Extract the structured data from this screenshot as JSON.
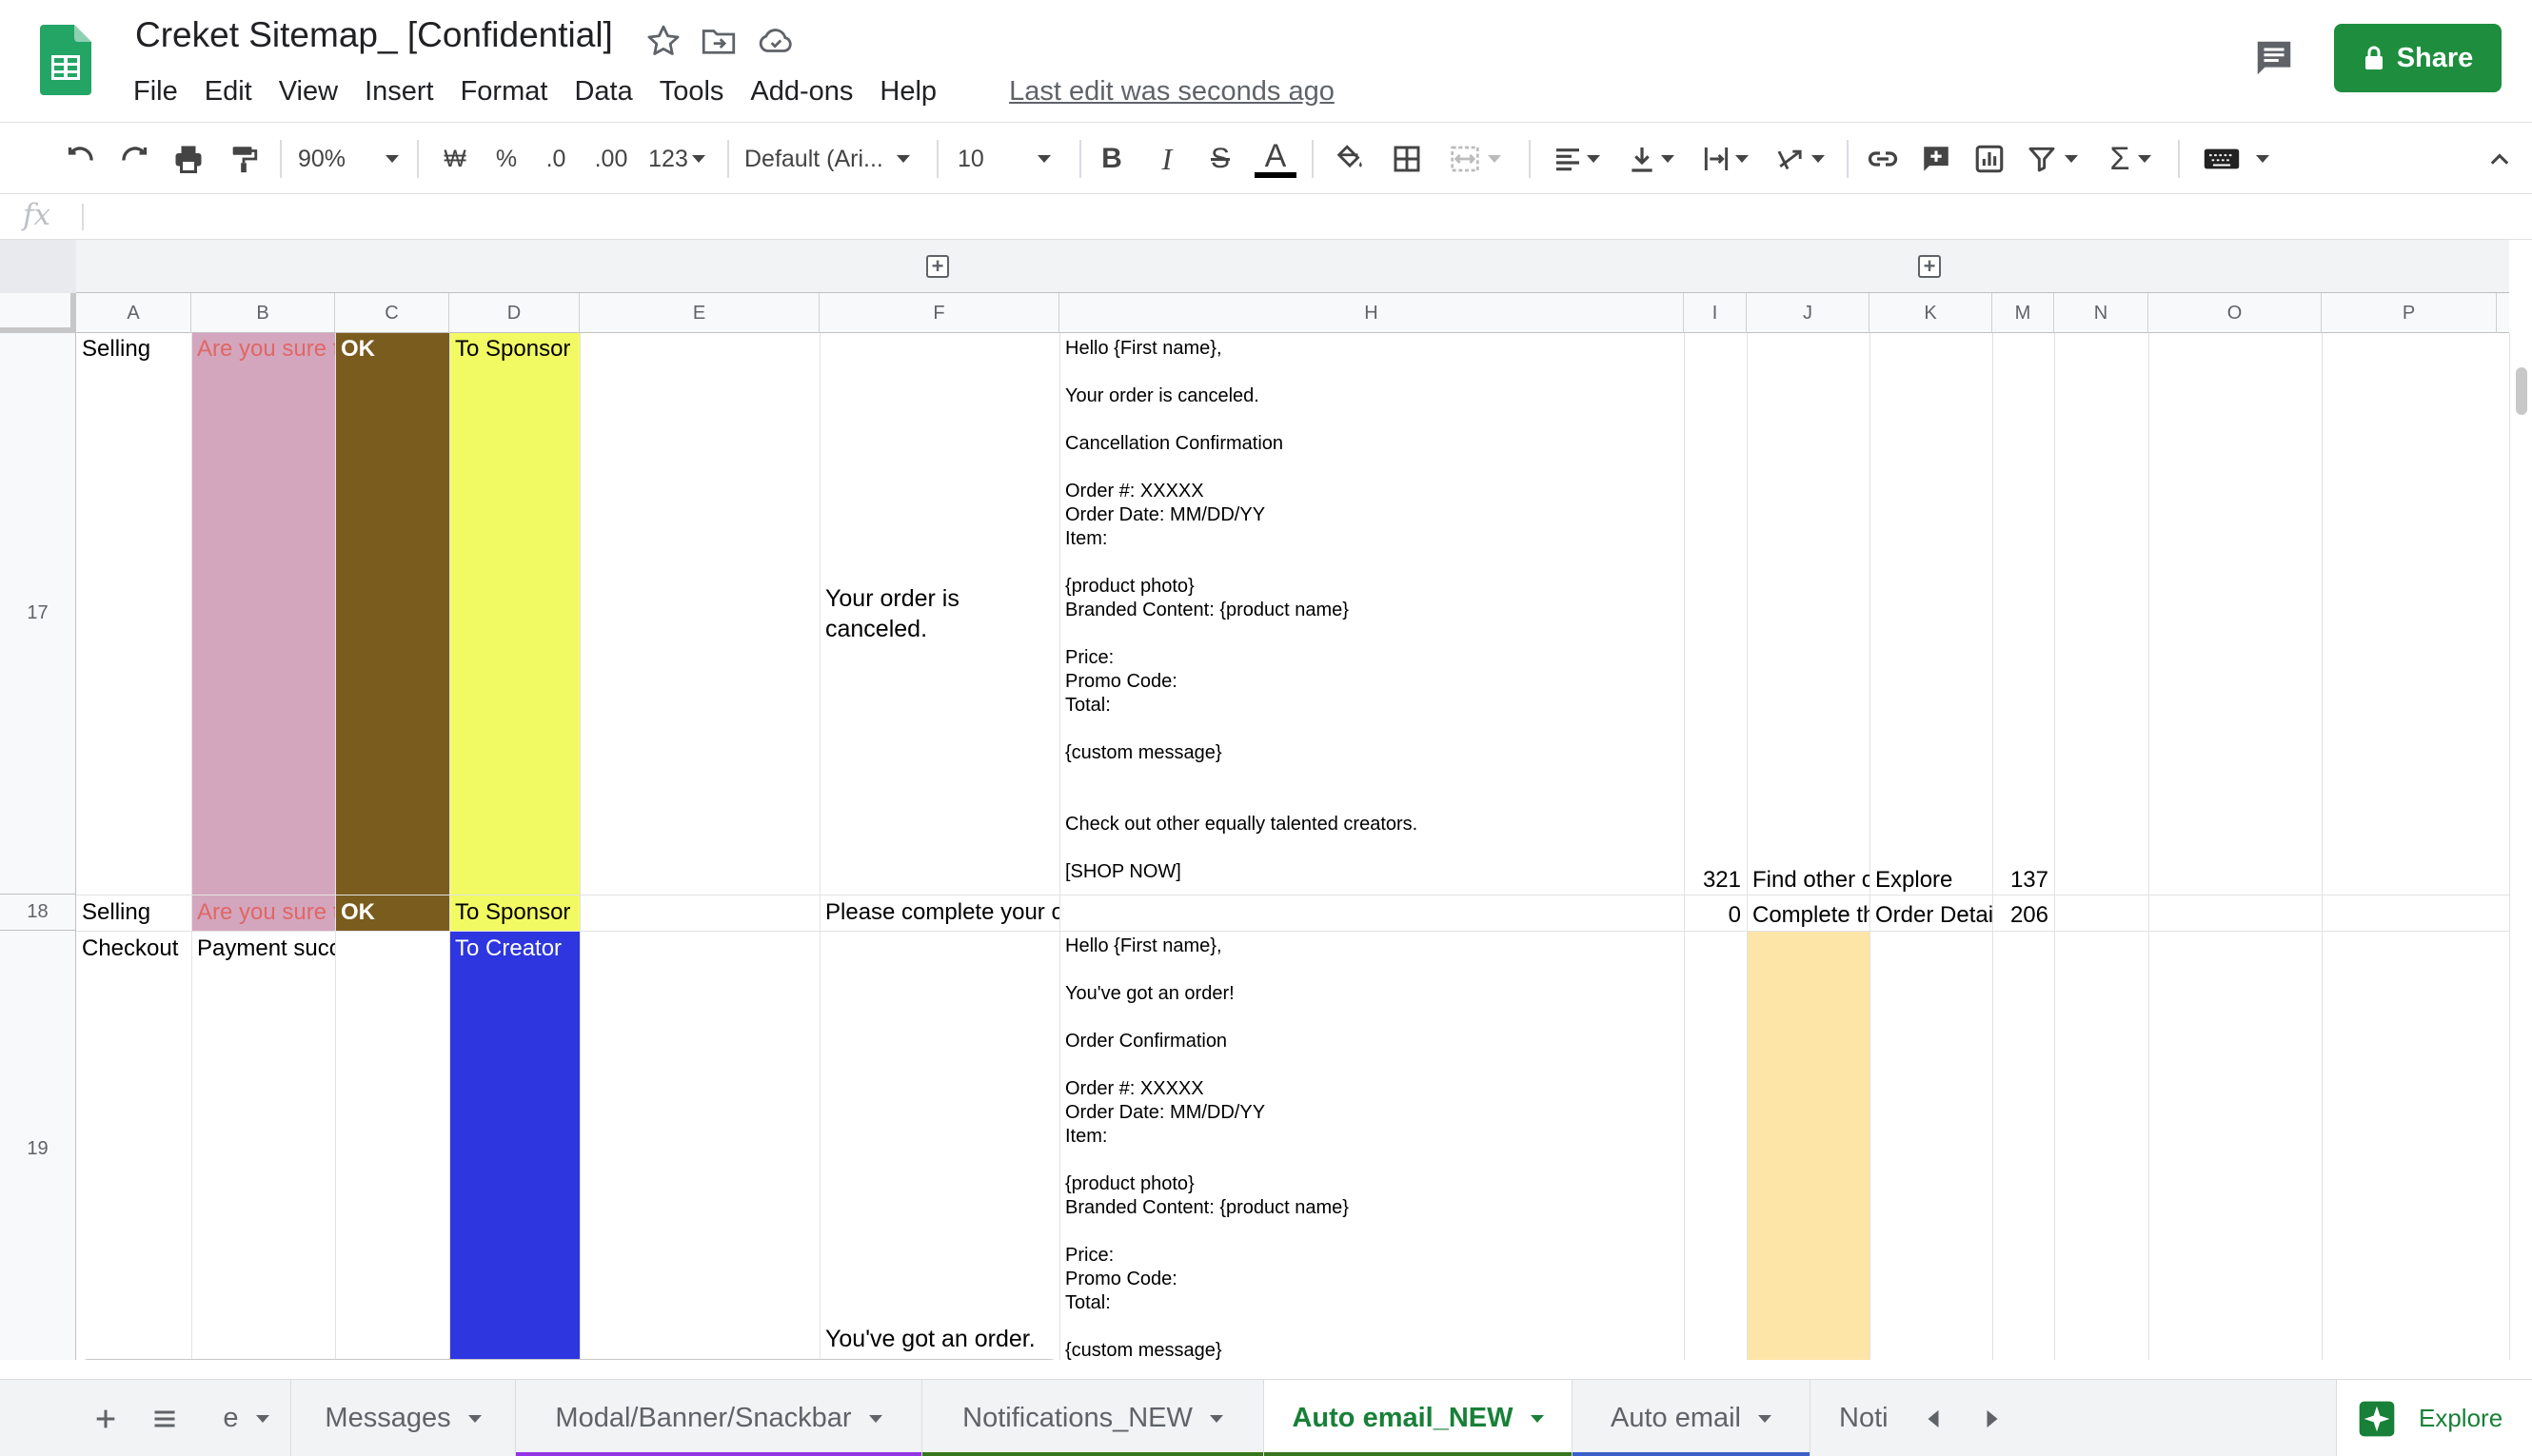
{
  "app": {
    "title": "Creket Sitemap_ [Confidential]",
    "last_edit": "Last edit was seconds ago",
    "share_label": "Share"
  },
  "menu": [
    "File",
    "Edit",
    "View",
    "Insert",
    "Format",
    "Data",
    "Tools",
    "Add-ons",
    "Help"
  ],
  "toolbar": {
    "zoom": "90%",
    "currency": "₩",
    "percent": "%",
    "decrease_decimals": ".0",
    "increase_decimals": ".00",
    "more_formats": "123",
    "font": "Default (Ari...",
    "font_size": "10",
    "bold": "B",
    "italic": "I",
    "strike": "S",
    "text_color": "A",
    "sum": "Σ"
  },
  "formula_bar": {
    "fx": "fx",
    "value": ""
  },
  "columns": [
    "A",
    "B",
    "C",
    "D",
    "E",
    "F",
    "H",
    "I",
    "J",
    "K",
    "M",
    "N",
    "O",
    "P"
  ],
  "rows": {
    "r17": {
      "number": "17",
      "A": "Selling",
      "B": "Are you sure t",
      "C": "OK",
      "D": "To Sponsor",
      "F": "Your order is canceled.",
      "H": "Hello {First name},\n\nYour order is canceled.\n\nCancellation Confirmation\n\nOrder #: XXXXX\nOrder Date: MM/DD/YY\nItem:\n\n{product photo}\nBranded Content: {product name}\n\nPrice:\nPromo Code:\nTotal:\n\n{custom message}\n\n\nCheck out other equally talented creators.\n\n[SHOP NOW]",
      "I": "321",
      "J": "Find other c",
      "K": "Explore",
      "M": "137"
    },
    "r18": {
      "number": "18",
      "A": "Selling",
      "B": "Are you sure t",
      "C": "OK",
      "D": "To Sponsor",
      "F": "Please complete your o",
      "I": "0",
      "J": "Complete th",
      "K": "Order Detail",
      "M": "206"
    },
    "r19": {
      "number": "19",
      "A": "Checkout",
      "B": "Payment success",
      "D": "To Creator",
      "F": "You've got an order.",
      "H": "Hello {First name},\n\nYou've got an order!\n\nOrder Confirmation\n\nOrder #: XXXXX\nOrder Date: MM/DD/YY\nItem:\n\n{product photo}\nBranded Content: {product name}\n\nPrice:\nPromo Code:\nTotal:\n\n{custom message}"
    }
  },
  "colors": {
    "pink_fill": "#d4a6bd",
    "brown_fill": "#7a5c1e",
    "yellow_fill": "#f2fa63",
    "blue_fill": "#2d36df",
    "peach_fill": "#fce5a6",
    "red_text": "#e06666",
    "accent_green": "#188038"
  },
  "sheet_tabs": [
    {
      "label": "e",
      "underline": ""
    },
    {
      "label": "Messages",
      "underline": ""
    },
    {
      "label": "Modal/Banner/Snackbar",
      "underline": "#9334e6"
    },
    {
      "label": "Notifications_NEW",
      "underline": "#38761d"
    },
    {
      "label": "Auto email_NEW",
      "underline": "#38761d",
      "active": true
    },
    {
      "label": "Auto email",
      "underline": "#3c5fc9"
    },
    {
      "label": "Noti",
      "underline": ""
    }
  ],
  "explore_label": "Explore"
}
